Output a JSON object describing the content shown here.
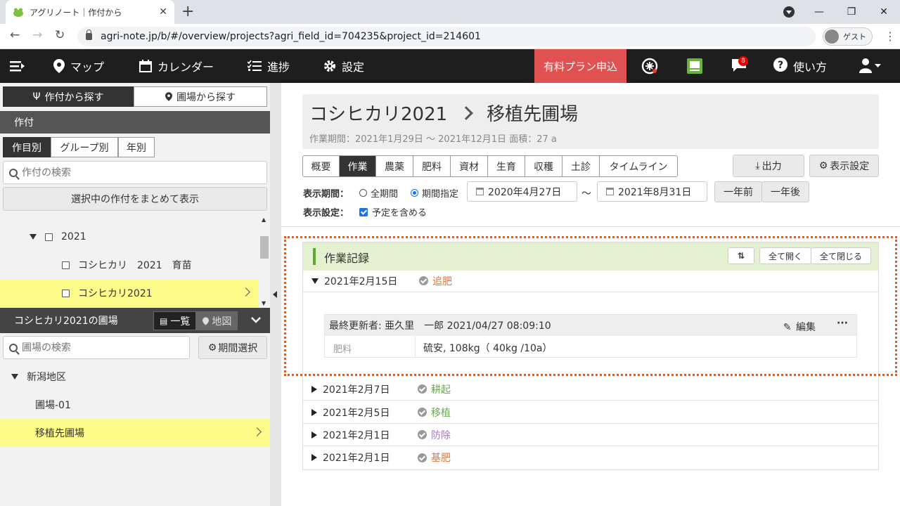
{
  "browser": {
    "tab_title": "アグリノート｜作付から",
    "url": "agri-note.jp/b/#/overview/projects?agri_field_id=704235&project_id=214601",
    "guest_label": "ゲスト"
  },
  "appnav": {
    "map": "マップ",
    "calendar": "カレンダー",
    "progress": "進捗",
    "settings": "設定",
    "premium": "有料プラン申込",
    "notification_count": "8",
    "help": "使い方"
  },
  "sidebar": {
    "search_tabs": [
      "作付から探す",
      "圃場から探す"
    ],
    "crop_header": "作付",
    "crop_view_tabs": [
      "作目別",
      "グループ別",
      "年別"
    ],
    "crop_search_placeholder": "作付の検索",
    "show_selected_button": "選択中の作付をまとめて表示",
    "tree": {
      "year": "2021",
      "items": [
        "コシヒカリ　2021　育苗",
        "コシヒカリ2021"
      ]
    },
    "field_header": "コシヒカリ2021の圃場",
    "list_label": "一覧",
    "map_label": "地図",
    "field_search_placeholder": "圃場の検索",
    "period_button": "期間選択",
    "region": "新潟地区",
    "fields": [
      "圃場-01",
      "移植先圃場"
    ]
  },
  "main": {
    "title_crop": "コシヒカリ2021",
    "title_field": "移植先圃場",
    "subtitle": "作業期間：2021年1月29日 ～ 2021年12月1日  面積：27 a",
    "tabs": [
      "概要",
      "作業",
      "農薬",
      "肥料",
      "資材",
      "生育",
      "収穫",
      "土診",
      "タイムライン"
    ],
    "export_button": "出力",
    "display_settings_button": "表示設定",
    "period_label": "表示期間：",
    "all_period": "全期間",
    "specified_period": "期間指定",
    "date_from": "2020年4月27日",
    "tilde": "～",
    "date_to": "2021年8月31日",
    "prev_year": "一年前",
    "next_year": "一年後",
    "display_setting_label": "表示設定：",
    "include_plan": "予定を含める",
    "records_title": "作業記録",
    "open_all": "全て開く",
    "close_all": "全て閉じる",
    "records": [
      {
        "date": "2021年2月15日",
        "work": "追肥",
        "color": "#e0763a"
      },
      {
        "date": "2021年2月7日",
        "work": "耕起",
        "color": "#6aa84f"
      },
      {
        "date": "2021年2月5日",
        "work": "移植",
        "color": "#6aa84f"
      },
      {
        "date": "2021年2月1日",
        "work": "防除",
        "color": "#a47ac6"
      },
      {
        "date": "2021年2月1日",
        "work": "基肥",
        "color": "#e0763a"
      }
    ],
    "detail": {
      "updater": "最終更新者: 亜久里　一郎   2021/04/27 08:09:10",
      "edit": "編集",
      "more": "···",
      "key": "肥料",
      "value": "硫安, 108kg（ 40kg /10a）"
    }
  }
}
